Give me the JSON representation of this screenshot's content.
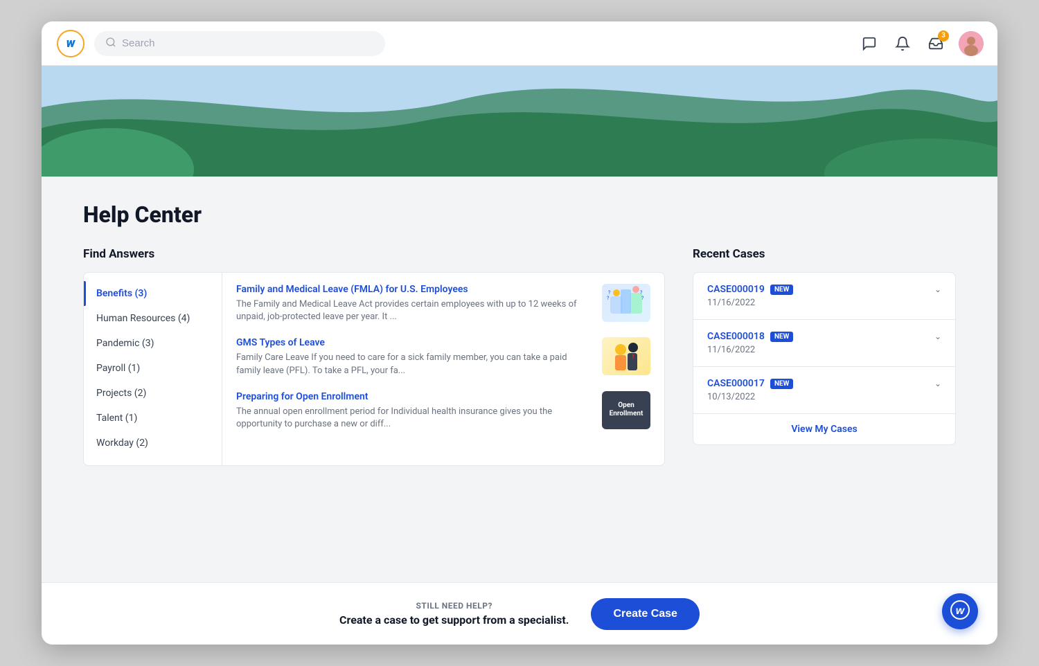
{
  "topnav": {
    "logo_letter": "w",
    "search_placeholder": "Search",
    "notification_count": "3"
  },
  "hero": {
    "title": "Help Center"
  },
  "find_answers": {
    "section_title": "Find Answers",
    "categories": [
      {
        "label": "Benefits (3)",
        "active": true
      },
      {
        "label": "Human Resources (4)",
        "active": false
      },
      {
        "label": "Pandemic (3)",
        "active": false
      },
      {
        "label": "Payroll (1)",
        "active": false
      },
      {
        "label": "Projects (2)",
        "active": false
      },
      {
        "label": "Talent (1)",
        "active": false
      },
      {
        "label": "Workday (2)",
        "active": false
      }
    ],
    "articles": [
      {
        "title": "Family and Medical Leave (FMLA) for U.S. Employees",
        "description": "The Family and Medical Leave Act provides certain employees with up to 12 weeks of unpaid, job-protected leave per year. It ...",
        "thumb_type": "fmla"
      },
      {
        "title": "GMS Types of Leave",
        "description": "Family Care Leave If you need to care for a sick family member, you can take a paid family leave (PFL). To take a PFL, your fa...",
        "thumb_type": "gms"
      },
      {
        "title": "Preparing for Open Enrollment",
        "description": "The annual open enrollment period for Individual health insurance gives you the opportunity to purchase a new or diff...",
        "thumb_type": "enrollment",
        "thumb_text": "Open\nEnrollment"
      }
    ]
  },
  "recent_cases": {
    "section_title": "Recent Cases",
    "cases": [
      {
        "number": "CASE000019",
        "badge": "NEW",
        "date": "11/16/2022"
      },
      {
        "number": "CASE000018",
        "badge": "NEW",
        "date": "11/16/2022"
      },
      {
        "number": "CASE000017",
        "badge": "NEW",
        "date": "10/13/2022"
      }
    ],
    "view_link": "View My Cases"
  },
  "bottom_bar": {
    "still_need_help": "STILL NEED HELP?",
    "description": "Create a case to get support from a specialist.",
    "create_case_label": "Create Case"
  }
}
